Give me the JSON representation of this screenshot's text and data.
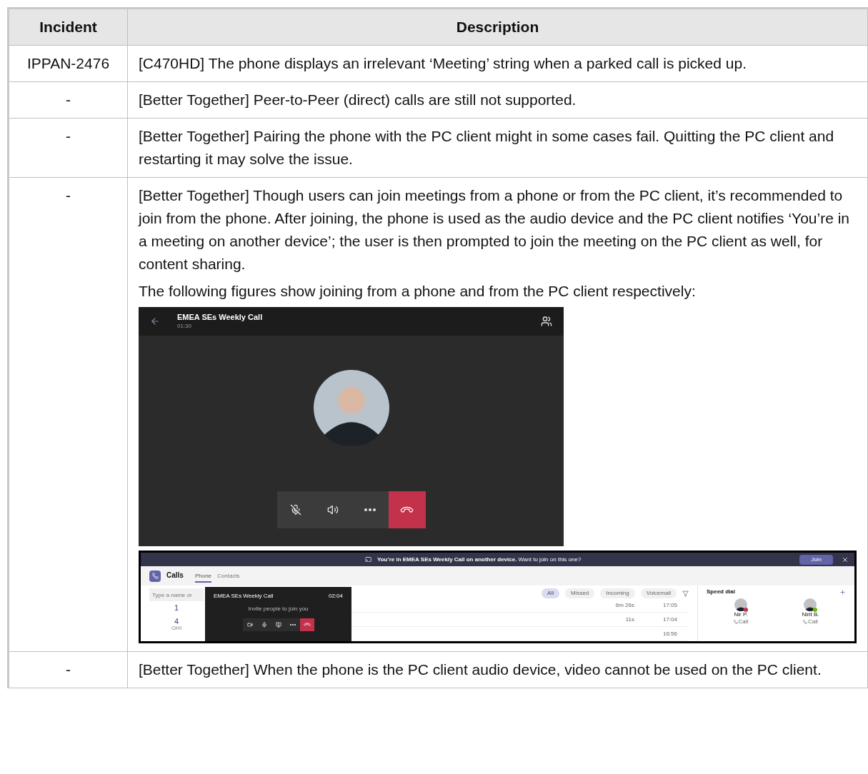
{
  "table": {
    "columns": [
      "Incident",
      "Description"
    ],
    "rows": [
      {
        "incident": "IPPAN-2476",
        "paragraphs": [
          "[C470HD] The phone displays an irrelevant ‘Meeting’ string when a parked call is picked up."
        ]
      },
      {
        "incident": "-",
        "paragraphs": [
          "[Better Together] Peer-to-Peer (direct) calls are still not supported."
        ]
      },
      {
        "incident": "-",
        "paragraphs": [
          "[Better Together] Pairing the phone with the PC client might in some cases fail. Quitting the PC client and restarting it may solve the issue."
        ]
      },
      {
        "incident": "-",
        "paragraphs": [
          "[Better Together] Though users can join meetings from a phone or from the PC client, it’s recommended to join from the phone. After joining, the phone is used as the audio device and the PC client notifies ‘You’re in a meeting on another device’; the user is then prompted to join the meeting on the PC client as well, for content sharing.",
          "The following figures show joining from a phone and from the PC client respectively:"
        ],
        "figures": [
          {
            "kind": "phone_screen",
            "title": "EMEA SEs Weekly Call",
            "duration": "01:30"
          },
          {
            "kind": "pc_client",
            "banner": {
              "text": "**You’re in EMEA SEs Weekly Call on another device.** Want to join on this one?",
              "button": "Join"
            },
            "app_title": "Calls",
            "tabs": [
              {
                "label": "Phone",
                "selected": true
              },
              {
                "label": "Contacts",
                "selected": false
              }
            ],
            "search": {
              "placeholder": "Type a name or"
            },
            "dial_keys": [
              {
                "digit": "1"
              },
              {
                "digit": "4",
                "letters": "GHI"
              }
            ],
            "filters": [
              {
                "label": "All",
                "selected": true
              },
              {
                "label": "Missed",
                "selected": false
              },
              {
                "label": "Incoming",
                "selected": false
              },
              {
                "label": "Voicemail",
                "selected": false
              }
            ],
            "calls": [
              {
                "duration": "6m 26s",
                "time": "17:05"
              },
              {
                "duration": "11s",
                "time": "17:04"
              },
              {
                "time": "16:56"
              }
            ],
            "speed_dial": {
              "title": "Speed dial",
              "contacts": [
                {
                  "name": "Nir P.",
                  "action": "Call",
                  "color": "#c4314b"
                },
                {
                  "name": "Nirit B.",
                  "action": "Call",
                  "color": "#6bb700"
                }
              ]
            },
            "mini_window": {
              "title": "EMEA SEs Weekly Call",
              "time": "02:04",
              "text": "Invite people to join you"
            }
          }
        ]
      },
      {
        "incident": "-",
        "paragraphs": [
          "[Better Together] When the phone is the PC client audio device, video cannot be used on the PC client."
        ]
      }
    ]
  }
}
